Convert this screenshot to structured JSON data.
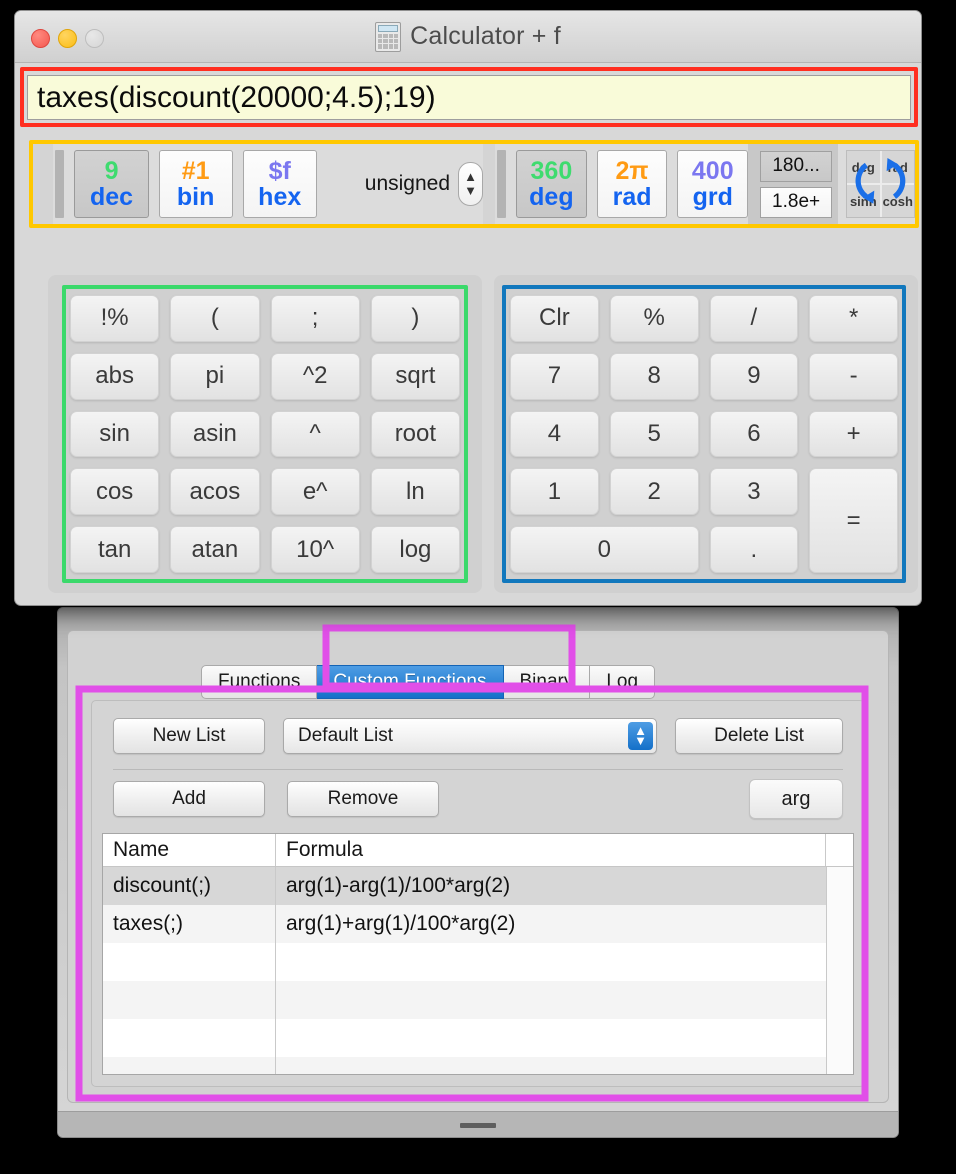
{
  "window": {
    "title": "Calculator + f",
    "title_icon": "calculator-icon",
    "traffic_lights": [
      "close",
      "minimize",
      "zoom"
    ]
  },
  "display": {
    "value": "taxes(discount(20000;4.5);19)",
    "highlight_color": "#ff2e20"
  },
  "toolbar": {
    "highlight_color": "#ffc800",
    "number_bases": [
      {
        "top": "9",
        "bottom": "dec",
        "top_color": "#3fdb6f",
        "selected": true
      },
      {
        "top": "#1",
        "bottom": "bin",
        "top_color": "#ff9b14",
        "selected": false
      },
      {
        "top": "$f",
        "bottom": "hex",
        "top_color": "#7b77f0",
        "selected": false
      }
    ],
    "sign_mode": "unsigned",
    "angle_units": [
      {
        "top": "360",
        "bottom": "deg",
        "top_color": "#3fdb6f",
        "selected": true
      },
      {
        "top": "2π",
        "bottom": "rad",
        "top_color": "#ff9b14",
        "selected": false
      },
      {
        "top": "400",
        "bottom": "grd",
        "top_color": "#7b77f0",
        "selected": false
      }
    ],
    "format_buttons": [
      {
        "label": "180...",
        "selected": true
      },
      {
        "label": "1.8e+",
        "selected": false
      }
    ],
    "hyp_toggle": {
      "cells": [
        "deg",
        "rad",
        "sinh",
        "cosh"
      ],
      "icon": "circular-arrows-icon"
    }
  },
  "function_keypad": {
    "highlight_color": "#3bd96b",
    "keys": [
      "!%",
      "(",
      ";",
      ")",
      "abs",
      "pi",
      "^2",
      "sqrt",
      "sin",
      "asin",
      "^",
      "root",
      "cos",
      "acos",
      "e^",
      "ln",
      "tan",
      "atan",
      "10^",
      "log"
    ]
  },
  "numeric_keypad": {
    "highlight_color": "#1278bd",
    "keys": [
      "Clr",
      "%",
      "/",
      "*",
      "7",
      "8",
      "9",
      "-",
      "4",
      "5",
      "6",
      "+",
      "1",
      "2",
      "3",
      "=",
      "0",
      "."
    ]
  },
  "tabs": {
    "highlight_color": "#e14fe8",
    "items": [
      {
        "label": "Functions",
        "active": false
      },
      {
        "label": "Custom Functions",
        "active": true
      },
      {
        "label": "Binary",
        "active": false
      },
      {
        "label": "Log",
        "active": false
      }
    ]
  },
  "custom_functions": {
    "new_list_label": "New List",
    "list_selected": "Default List",
    "delete_list_label": "Delete List",
    "add_label": "Add",
    "remove_label": "Remove",
    "arg_label": "arg",
    "table": {
      "columns": [
        "Name",
        "Formula"
      ],
      "rows": [
        {
          "name": "discount(;)",
          "formula": "arg(1)-arg(1)/100*arg(2)",
          "selected": true
        },
        {
          "name": "taxes(;)",
          "formula": "arg(1)+arg(1)/100*arg(2)",
          "selected": false
        },
        {
          "name": "",
          "formula": "",
          "selected": false
        },
        {
          "name": "",
          "formula": "",
          "selected": false
        },
        {
          "name": "",
          "formula": "",
          "selected": false
        },
        {
          "name": "",
          "formula": "",
          "selected": false
        }
      ]
    }
  }
}
